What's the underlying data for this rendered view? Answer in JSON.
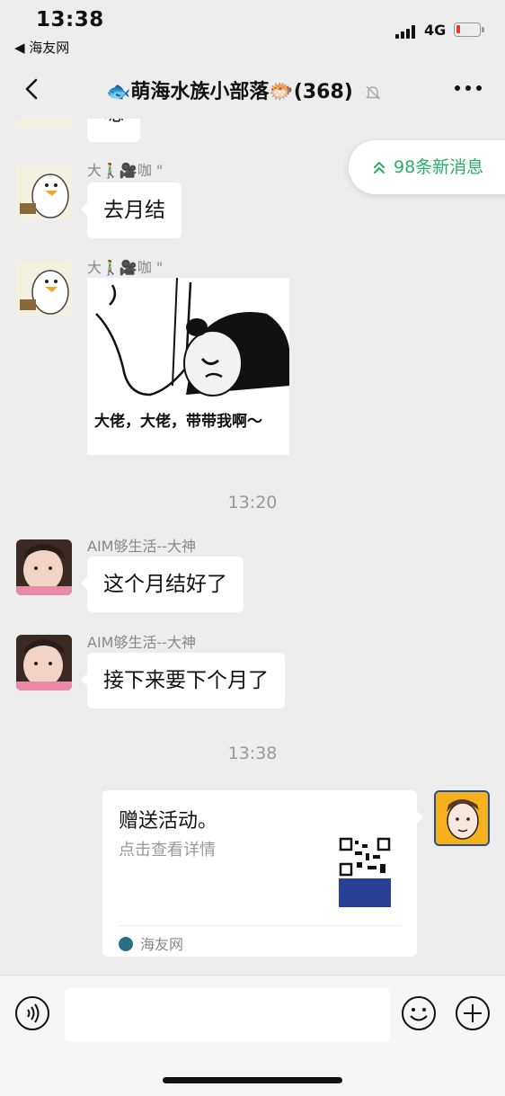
{
  "status_bar": {
    "time": "13:38",
    "back_app": "◀ 海友网",
    "network": "4G",
    "battery_level_percent": 10
  },
  "nav": {
    "title": "🐟萌海水族小部落🐡(368)"
  },
  "new_messages": {
    "label": "98条新消息"
  },
  "messages": [
    {
      "sender": "",
      "text": "嗯"
    },
    {
      "sender": "大🚶‍♂️🎥咖 \"",
      "text": "去月结"
    },
    {
      "sender": "大🚶‍♂️🎥咖 \"",
      "sticker_caption": "大佬，大佬，带带我啊～"
    },
    {
      "sender": "AIM够生活--大神",
      "text": "这个月结好了"
    },
    {
      "sender": "AIM够生活--大神",
      "text": "接下来要下个月了"
    }
  ],
  "timestamps": [
    "13:20",
    "13:38"
  ],
  "card": {
    "title": "赠送活动。",
    "desc": "点击查看详情",
    "source": "海友网"
  },
  "input": {
    "placeholder": ""
  }
}
